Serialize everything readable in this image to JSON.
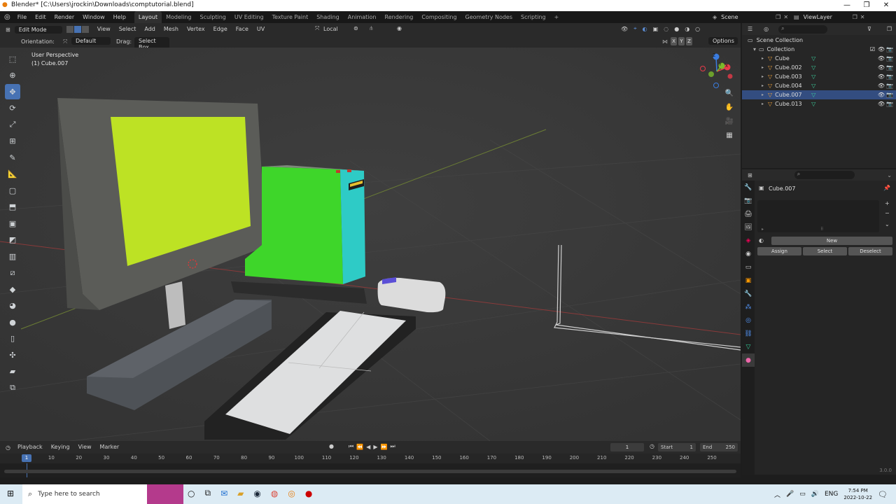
{
  "window": {
    "title": "Blender* [C:\\Users\\jrockin\\Downloads\\comptutorial.blend]",
    "minimize": "—",
    "maximize": "❐",
    "close": "✕"
  },
  "menu": {
    "items": [
      "File",
      "Edit",
      "Render",
      "Window",
      "Help"
    ]
  },
  "workspaces": [
    "Layout",
    "Modeling",
    "Sculpting",
    "UV Editing",
    "Texture Paint",
    "Shading",
    "Animation",
    "Rendering",
    "Compositing",
    "Geometry Nodes",
    "Scripting"
  ],
  "active_workspace": "Layout",
  "add_workspace": "+",
  "scene": {
    "label": "Scene",
    "viewlayer": "ViewLayer"
  },
  "viewport_header": {
    "mode": "Edit Mode",
    "menus": [
      "View",
      "Select",
      "Add",
      "Mesh",
      "Vertex",
      "Edge",
      "Face",
      "UV"
    ],
    "pivot": "Local",
    "orientation_label": "Orientation:",
    "orientation_value": "Default",
    "drag_label": "Drag:",
    "drag_value": "Select Box",
    "axes": [
      "X",
      "Y",
      "Z"
    ],
    "options": "Options"
  },
  "viewport_overlay": {
    "perspective": "User Perspective",
    "object": "(1) Cube.007"
  },
  "gizmo": {
    "x": "X",
    "y": "Y",
    "z": "Z"
  },
  "outliner": {
    "root": "Scene Collection",
    "collection": "Collection",
    "objects": [
      {
        "name": "Cube",
        "selected": false
      },
      {
        "name": "Cube.002",
        "selected": false
      },
      {
        "name": "Cube.003",
        "selected": false
      },
      {
        "name": "Cube.004",
        "selected": false
      },
      {
        "name": "Cube.007",
        "selected": true
      },
      {
        "name": "Cube.013",
        "selected": false
      }
    ]
  },
  "properties": {
    "object_name": "Cube.007",
    "new": "New",
    "assign": "Assign",
    "select": "Select",
    "deselect": "Deselect"
  },
  "timeline": {
    "menus": [
      "Playback",
      "Keying",
      "View",
      "Marker"
    ],
    "current_frame": "1",
    "start_label": "Start",
    "start": "1",
    "end_label": "End",
    "end": "250",
    "ticks": [
      "10",
      "20",
      "30",
      "40",
      "50",
      "60",
      "70",
      "80",
      "90",
      "100",
      "110",
      "120",
      "130",
      "140",
      "150",
      "160",
      "170",
      "180",
      "190",
      "200",
      "210",
      "220",
      "230",
      "240",
      "250"
    ],
    "playhead": "1"
  },
  "version": "3.0.0",
  "taskbar": {
    "search": "Type here to search",
    "lang": "ENG",
    "time": "7:54 PM",
    "date": "2022-10-22"
  },
  "colors": {
    "accent": "#4772b3",
    "selected_row": "#334d80",
    "monitor_screen": "#bde224",
    "tower_front": "#3ed62a",
    "tower_side": "#2ecbc6"
  }
}
